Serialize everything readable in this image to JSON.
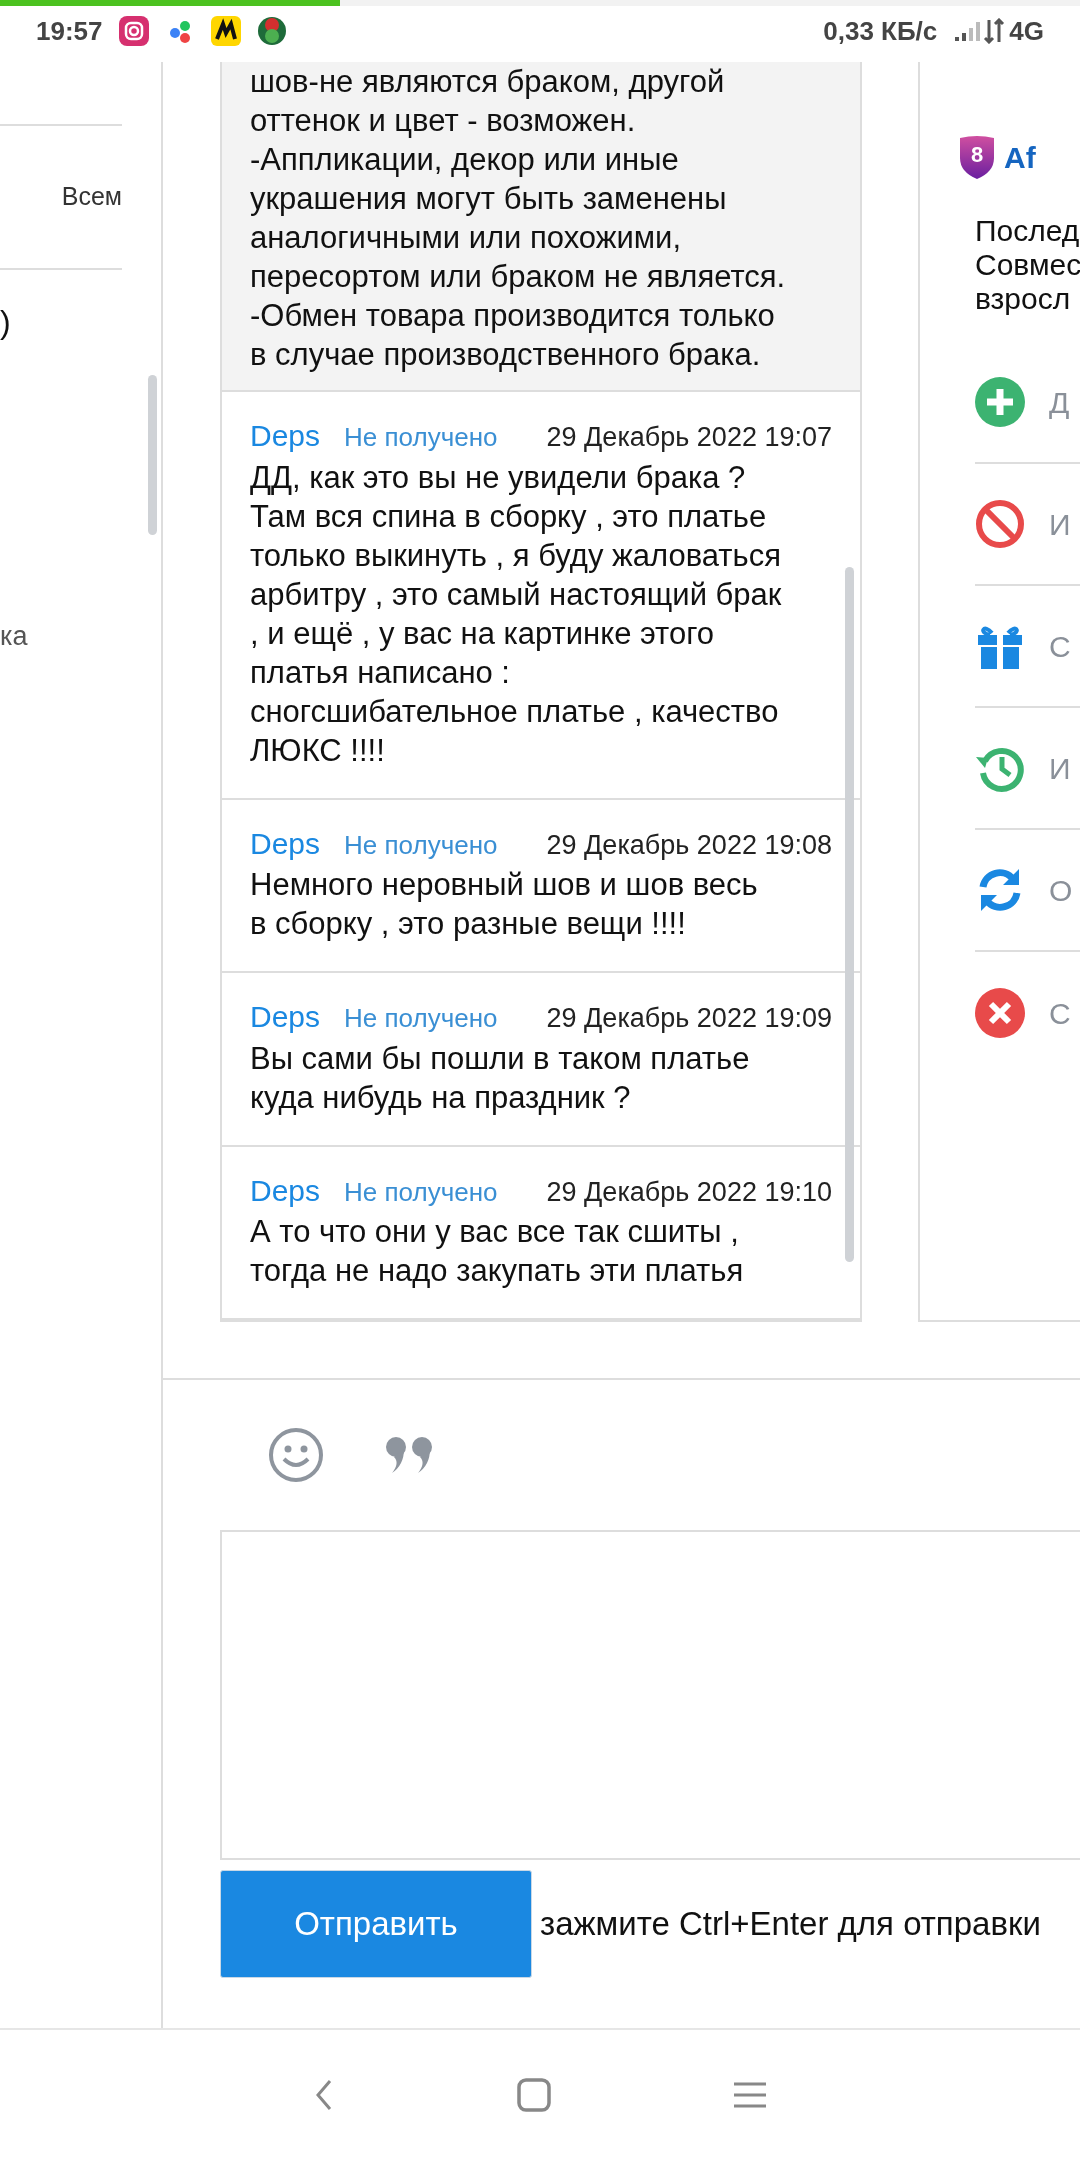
{
  "status_bar": {
    "time": "19:57",
    "net_speed": "0,33 КБ/с",
    "network": "4G",
    "load": {
      "level": 0.315
    }
  },
  "sidebar": {
    "items": [
      {
        "text": "Всем"
      },
      {
        "text": ")"
      },
      {
        "text": "ка"
      }
    ]
  },
  "chat": {
    "messages": [
      {
        "kind": "notice",
        "text": "шов-не являются браком, другой\nоттенок и цвет - возможен.\n-Аппликации, декор или иные\nукрашения могут быть заменены\nаналогичными или похожими,\nпересортом или браком не является.\n-Обмен товара производится только\nв случае производственного брака."
      },
      {
        "kind": "message",
        "author": "Deps",
        "status": "Не получено",
        "date": "29 Декабрь 2022 19:07",
        "text": "ДД, как это вы не увидели брака ?\nТам вся спина в сборку , это платье\nтолько выкинуть , я буду жаловаться\nарбитру , это самый настоящий брак\n, и ещё , у вас на картинке этого\nплатья написано :\nсногсшибательное платье , качество\nЛЮКС !!!!"
      },
      {
        "kind": "message",
        "author": "Deps",
        "status": "Не получено",
        "date": "29 Декабрь 2022 19:08",
        "text": "Немного неровный шов и шов весь\nв сборку , это разные вещи !!!!"
      },
      {
        "kind": "message",
        "author": "Deps",
        "status": "Не получено",
        "date": "29 Декабрь 2022 19:09",
        "text": "Вы сами бы пошли в таком платье\nкуда нибудь на праздник ?"
      },
      {
        "kind": "message",
        "author": "Deps",
        "status": "Не получено",
        "date": "29 Декабрь 2022 19:10",
        "text": "А то что они у вас все так сшиты ,\nтогда не надо закупать эти платья"
      }
    ]
  },
  "profile": {
    "badge": "8",
    "title": "Af",
    "description": [
      "Послед",
      "Совмес",
      "взросл"
    ],
    "actions": [
      {
        "kind": "add",
        "color": "#3cb371",
        "label": "Д"
      },
      {
        "kind": "block",
        "color": "#e84a4a",
        "label": "И"
      },
      {
        "kind": "gift",
        "color": "#1a88e1",
        "label": "С"
      },
      {
        "kind": "history",
        "color": "#3cb371",
        "label": "И"
      },
      {
        "kind": "sync",
        "color": "#1a88e1",
        "label": "О"
      },
      {
        "kind": "close",
        "color": "#e84a4a",
        "label": "С"
      }
    ]
  },
  "composer": {
    "send_button": "Отправить",
    "hint": "зажмите Ctrl+Enter для отправки"
  }
}
